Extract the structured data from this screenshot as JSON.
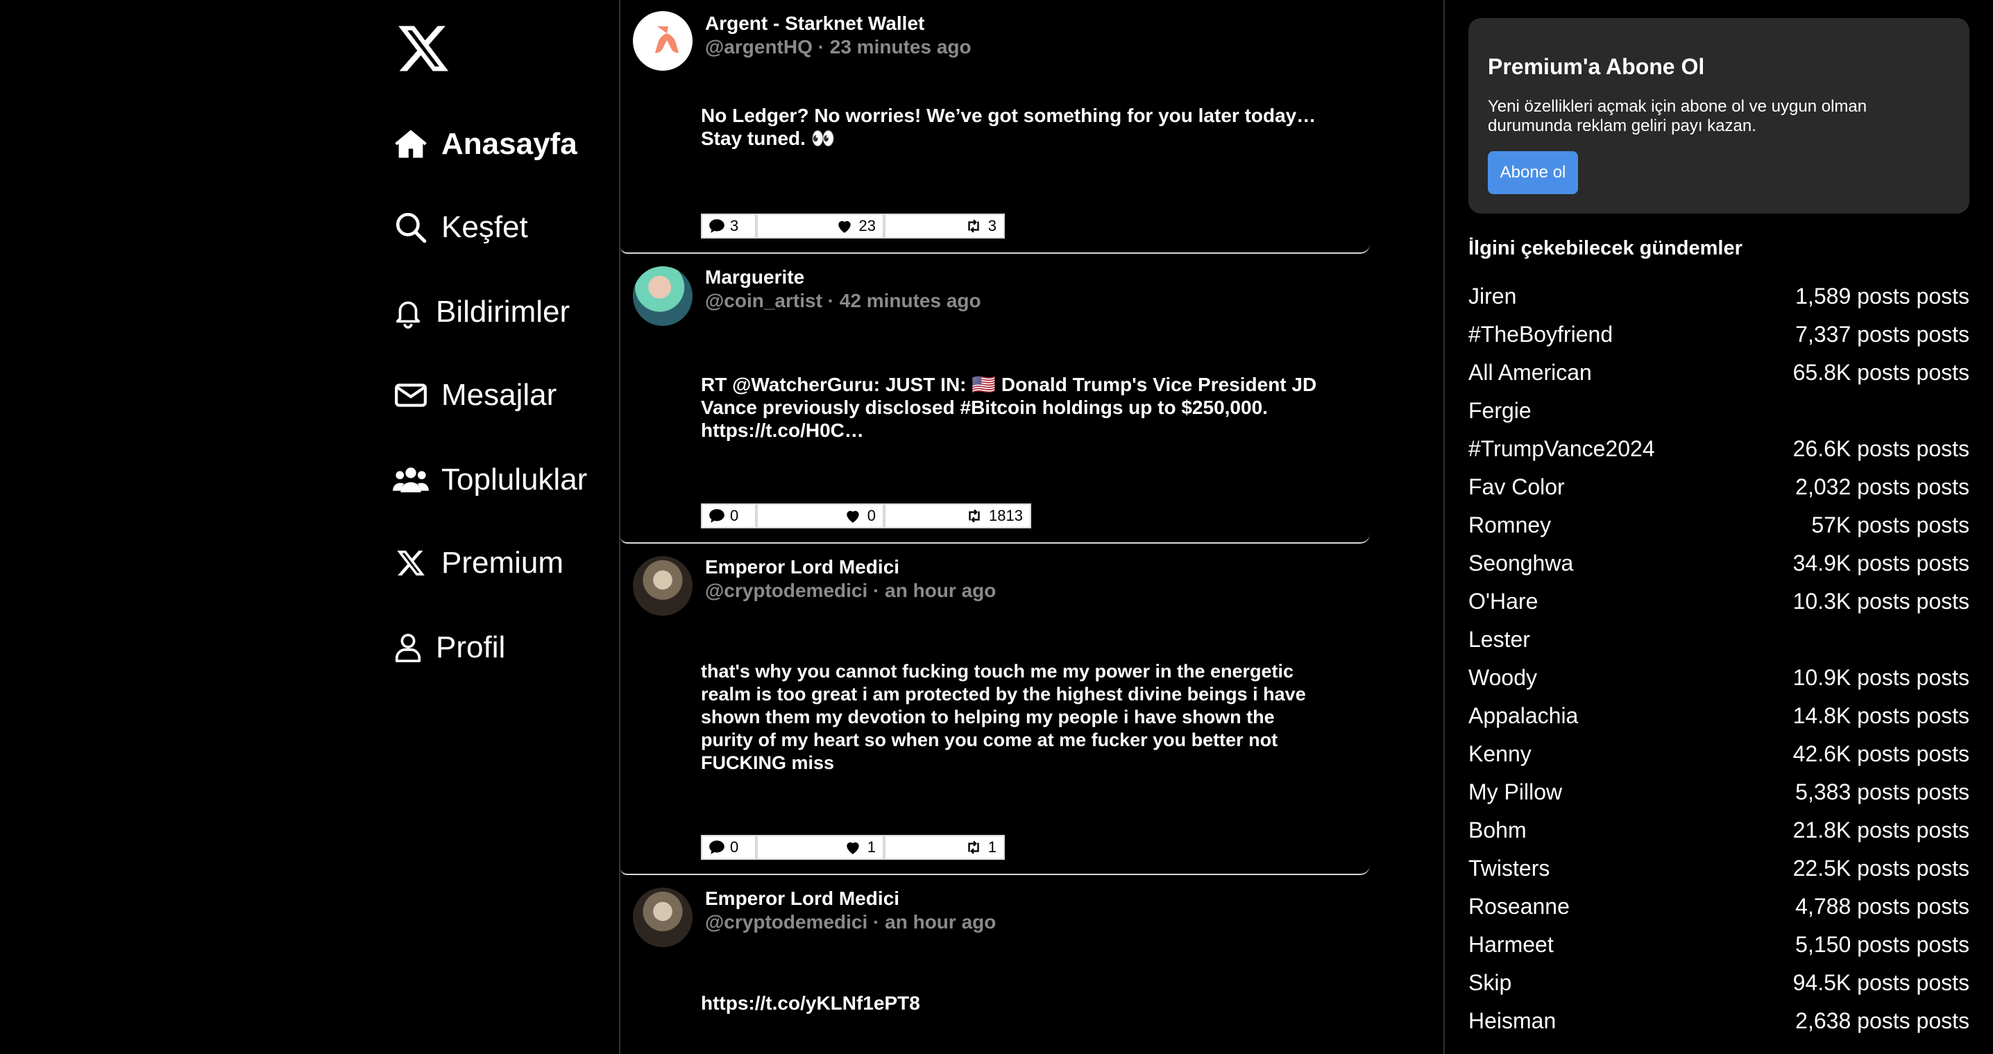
{
  "nav": {
    "items": [
      {
        "label": "Anasayfa",
        "icon": "home-icon",
        "active": true
      },
      {
        "label": "Keşfet",
        "icon": "search-icon"
      },
      {
        "label": "Bildirimler",
        "icon": "bell-icon"
      },
      {
        "label": "Mesajlar",
        "icon": "envelope-icon"
      },
      {
        "label": "Topluluklar",
        "icon": "people-icon"
      },
      {
        "label": "Premium",
        "icon": "x-logo-icon"
      },
      {
        "label": "Profil",
        "icon": "person-icon"
      }
    ]
  },
  "feed": {
    "tweets": [
      {
        "name": "Argent - Starknet Wallet",
        "meta": "@argentHQ · 23 minutes ago",
        "text": "No Ledger? No worries! We’ve got something for you later today…\nStay tuned. 👀",
        "replies": "3",
        "likes": "23",
        "retweets": "3",
        "avatar": "argent-logo-avatar"
      },
      {
        "name": "Marguerite",
        "meta": "@coin_artist · 42 minutes ago",
        "text": "RT @WatcherGuru: JUST IN: 🇺🇸 Donald Trump's Vice President JD\nVance previously disclosed #Bitcoin holdings up to $250,000.\nhttps://t.co/H0C…",
        "replies": "0",
        "likes": "0",
        "retweets": "1813",
        "avatar": "profile-photo-avatar"
      },
      {
        "name": "Emperor Lord Medici",
        "meta": "@cryptodemedici · an hour ago",
        "text": "that's why you cannot fucking touch me my power in the energetic\nrealm is too great i am protected by the highest divine beings i have\nshown them my devotion to helping my people i have shown the\npurity of my heart so when you come at me fucker you better not\nFUCKING miss",
        "replies": "0",
        "likes": "1",
        "retweets": "1",
        "avatar": "profile-photo-avatar"
      },
      {
        "name": "Emperor Lord Medici",
        "meta": "@cryptodemedici · an hour ago",
        "text": "https://t.co/yKLNf1ePT8",
        "avatar": "profile-photo-avatar"
      }
    ]
  },
  "premium": {
    "title": "Premium'a Abone Ol",
    "description": "Yeni özellikleri açmak için abone ol ve uygun olman durumunda reklam geliri payı kazan.",
    "button": "Abone ol"
  },
  "trends": {
    "title": "İlgini çekebilecek gündemler",
    "items": [
      {
        "name": "Jiren",
        "count": "1,589 posts posts"
      },
      {
        "name": "#TheBoyfriend",
        "count": "7,337 posts posts"
      },
      {
        "name": "All American",
        "count": "65.8K posts posts"
      },
      {
        "name": "Fergie",
        "count": ""
      },
      {
        "name": "#TrumpVance2024",
        "count": "26.6K posts posts"
      },
      {
        "name": "Fav Color",
        "count": "2,032 posts posts"
      },
      {
        "name": "Romney",
        "count": "57K posts posts"
      },
      {
        "name": "Seonghwa",
        "count": "34.9K posts posts"
      },
      {
        "name": "O'Hare",
        "count": "10.3K posts posts"
      },
      {
        "name": "Lester",
        "count": ""
      },
      {
        "name": "Woody",
        "count": "10.9K posts posts"
      },
      {
        "name": "Appalachia",
        "count": "14.8K posts posts"
      },
      {
        "name": "Kenny",
        "count": "42.6K posts posts"
      },
      {
        "name": "My Pillow",
        "count": "5,383 posts posts"
      },
      {
        "name": "Bohm",
        "count": "21.8K posts posts"
      },
      {
        "name": "Twisters",
        "count": "22.5K posts posts"
      },
      {
        "name": "Roseanne",
        "count": "4,788 posts posts"
      },
      {
        "name": "Harmeet",
        "count": "5,150 posts posts"
      },
      {
        "name": "Skip",
        "count": "94.5K posts posts"
      },
      {
        "name": "Heisman",
        "count": "2,638 posts posts"
      }
    ]
  }
}
